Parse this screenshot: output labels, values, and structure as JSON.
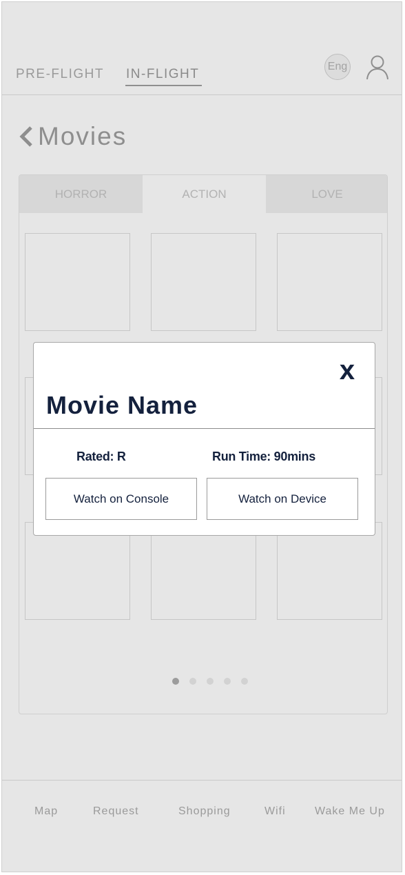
{
  "header": {
    "tabs": [
      {
        "label": "PRE-FLIGHT",
        "active": false
      },
      {
        "label": "IN-FLIGHT",
        "active": true
      }
    ],
    "language": "Eng",
    "user_icon": "user-icon"
  },
  "page": {
    "back_icon": "chevron-left-icon",
    "title": "Movies"
  },
  "genre_tabs": [
    {
      "label": "HORROR",
      "active": false
    },
    {
      "label": "ACTION",
      "active": true
    },
    {
      "label": "LOVE",
      "active": false
    }
  ],
  "pagination": {
    "total": 5,
    "current": 1
  },
  "modal": {
    "close_label": "x",
    "title": "Movie Name",
    "rated": "Rated: R",
    "run_time": "Run Time: 90mins",
    "buttons": [
      "Watch on Console",
      "Watch on Device"
    ]
  },
  "bottom_nav": [
    "Map",
    "Request",
    "Shopping",
    "Wifi",
    "Wake Me Up"
  ],
  "colors": {
    "background": "#e6e6e6",
    "modal_text": "#14213d",
    "muted_text": "#9a9a9a"
  }
}
